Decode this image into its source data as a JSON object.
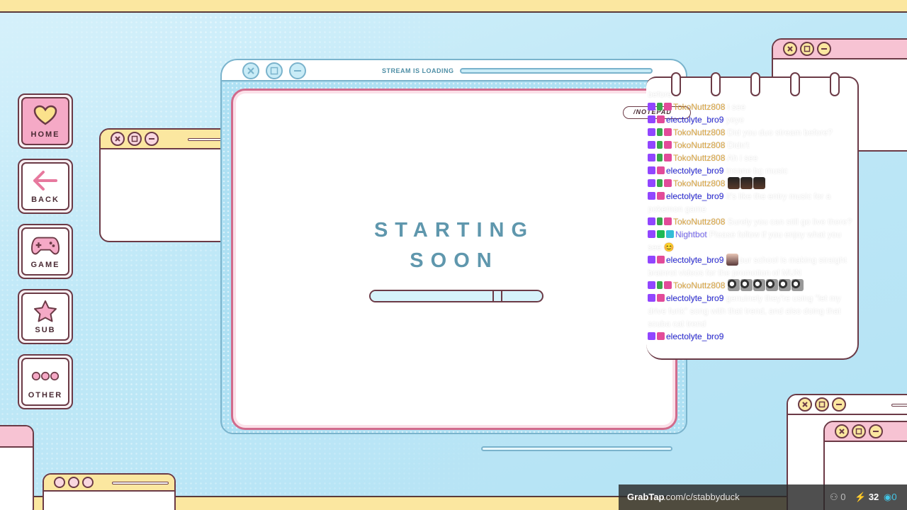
{
  "nav": [
    {
      "label": "HOME",
      "icon": "heart-icon",
      "active": true
    },
    {
      "label": "BACK",
      "icon": "arrow-left-icon",
      "active": false
    },
    {
      "label": "GAME",
      "icon": "gamepad-icon",
      "active": false
    },
    {
      "label": "SUB",
      "icon": "star-icon",
      "active": false
    },
    {
      "label": "OTHER",
      "icon": "more-icon",
      "active": false
    }
  ],
  "main": {
    "status_label": "STREAM IS LOADING",
    "title_line1": "STARTING",
    "title_line2": "SOON",
    "progress_fraction": 0.72
  },
  "notepad": {
    "tag_label": "/NOTEPAD"
  },
  "chat": {
    "top_cutoff": "before",
    "messages": [
      {
        "user": "TokoNuttz808",
        "user_color": "#d9a441",
        "text": "i see",
        "badges": [
          "tw",
          "sword",
          "heart"
        ]
      },
      {
        "user": "electolyte_bro9",
        "user_color": "#2b2bd6",
        "text": "yeye",
        "badges": [
          "tw",
          "heart"
        ]
      },
      {
        "user": "TokoNuttz808",
        "user_color": "#d9a441",
        "text": "Did you duo stream before?",
        "badges": [
          "tw",
          "sword",
          "heart"
        ]
      },
      {
        "user": "TokoNuttz808",
        "user_color": "#d9a441",
        "text": "Didn't",
        "badges": [
          "tw",
          "sword",
          "heart"
        ]
      },
      {
        "user": "TokoNuttz808",
        "user_color": "#d9a441",
        "text": "Ah i see",
        "badges": [
          "tw",
          "sword",
          "heart"
        ]
      },
      {
        "user": "electolyte_bro9",
        "user_color": "#2b2bd6",
        "text": "insane bg music",
        "badges": [
          "tw",
          "heart"
        ]
      },
      {
        "user": "TokoNuttz808",
        "user_color": "#d9a441",
        "text": "",
        "badges": [
          "tw",
          "sword",
          "heart"
        ],
        "emotes": [
          "dog",
          "dog",
          "dog"
        ]
      },
      {
        "user": "electolyte_bro9",
        "user_color": "#2b2bd6",
        "text": "it's like the entry music for a pokemon game",
        "badges": [
          "tw",
          "heart"
        ]
      },
      {
        "user": "TokoNuttz808",
        "user_color": "#d9a441",
        "text": "Surely you can still go live there?",
        "badges": [
          "tw",
          "sword",
          "heart"
        ]
      },
      {
        "user": "Nightbot",
        "user_color": "#7a6cf0",
        "text": "Please follow if you enjoy what you see 😊",
        "badges": [
          "tw",
          "mod",
          "bot"
        ]
      },
      {
        "user": "electolyte_bro9",
        "user_color": "#2b2bd6",
        "text": "our school is making straight brainrot videos for the promotion of MUN",
        "badges": [
          "tw",
          "heart"
        ],
        "emotes_before": [
          "girl"
        ]
      },
      {
        "user": "TokoNuttz808",
        "user_color": "#d9a441",
        "text": "",
        "badges": [
          "tw",
          "sword",
          "heart"
        ],
        "emotes": [
          "owl",
          "owl",
          "owl",
          "owl",
          "owl",
          "owl"
        ]
      },
      {
        "user": "electolyte_bro9",
        "user_color": "#2b2bd6",
        "text": "genuinely they're using \"let my drive funk\" song with that trend, and also doing that scuba cat trend",
        "badges": [
          "tw",
          "heart"
        ]
      },
      {
        "user": "electolyte_bro9",
        "user_color": "#2b2bd6",
        "text": "",
        "badges": [
          "tw",
          "heart"
        ]
      }
    ]
  },
  "footer": {
    "brand": "GrabTap",
    "url": ".com/c/stabbyduck",
    "viewers": "0",
    "boosts": "32",
    "points": "0"
  },
  "colors": {
    "accent_pink": "#f5a9c6",
    "accent_yellow": "#fbe7a0",
    "outline": "#6b3a46",
    "title_blue": "#5f97ad"
  }
}
